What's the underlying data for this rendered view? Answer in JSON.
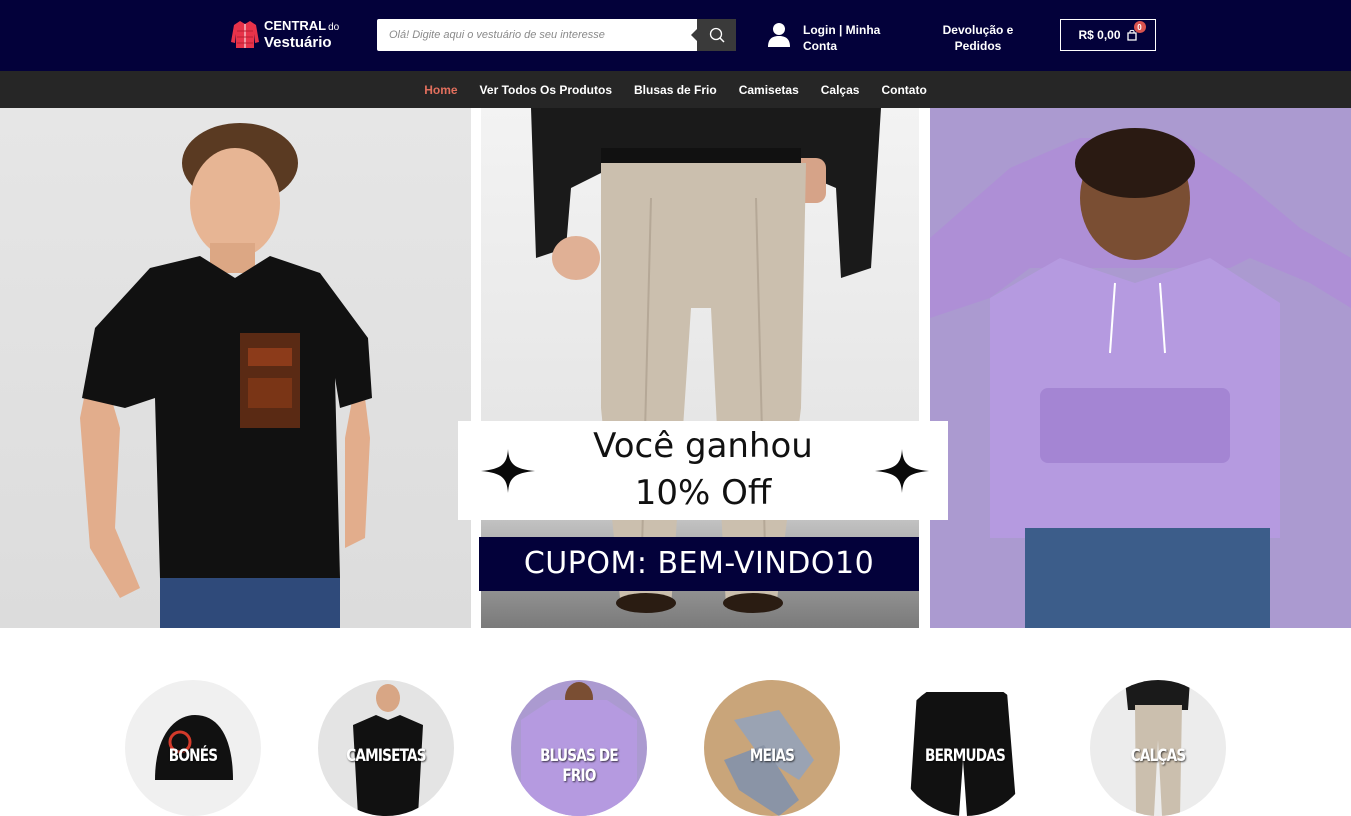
{
  "header": {
    "logo_line1": "CENTRAL",
    "logo_line1_small": "do",
    "logo_line2": "Vestuário",
    "search_placeholder": "Olá! Digite aqui o vestuário de seu interesse",
    "login_label": "Login | Minha Conta",
    "returns_label": "Devolução e Pedidos",
    "cart_total": "R$ 0,00",
    "cart_count": "0"
  },
  "nav": {
    "items": [
      {
        "label": "Home",
        "active": true
      },
      {
        "label": "Ver Todos Os Produtos"
      },
      {
        "label": "Blusas de Frio"
      },
      {
        "label": "Camisetas"
      },
      {
        "label": "Calças"
      },
      {
        "label": "Contato"
      }
    ]
  },
  "hero": {
    "promo_line1": "Você ganhou",
    "promo_line2": "10% Off",
    "coupon": "CUPOM: BEM-VINDO10"
  },
  "categories": [
    {
      "label": "BONÉS"
    },
    {
      "label": "CAMISETAS"
    },
    {
      "label": "BLUSAS DE FRIO"
    },
    {
      "label": "MEIAS"
    },
    {
      "label": "BERMUDAS"
    },
    {
      "label": "CALÇAS"
    }
  ],
  "colors": {
    "header_bg": "#03013a",
    "nav_bg": "#262626",
    "nav_active": "#e26f5d",
    "cart_badge": "#d9534f"
  }
}
